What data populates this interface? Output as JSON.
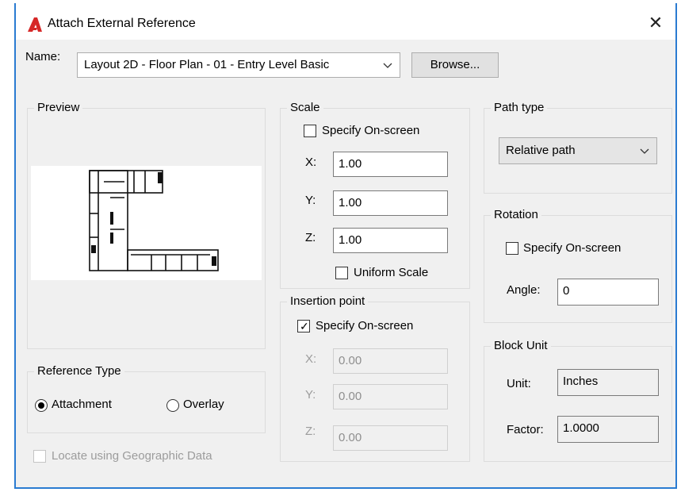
{
  "window": {
    "title": "Attach External Reference",
    "close_glyph": "✕",
    "icon": "autocad-logo-icon",
    "accent": "#2a7bd1",
    "logo_color": "#d62828"
  },
  "name_row": {
    "label": "Name:",
    "value": "Layout 2D - Floor Plan - 01 - Entry Level Basic",
    "browse_label": "Browse..."
  },
  "preview": {
    "title": "Preview"
  },
  "scale": {
    "title": "Scale",
    "specify_label": "Specify On-screen",
    "specify_checked": false,
    "x_label": "X:",
    "x_value": "1.00",
    "y_label": "Y:",
    "y_value": "1.00",
    "z_label": "Z:",
    "z_value": "1.00",
    "uniform_label": "Uniform Scale",
    "uniform_checked": false
  },
  "insertion": {
    "title": "Insertion point",
    "specify_label": "Specify On-screen",
    "specify_checked": true,
    "x_label": "X:",
    "x_value": "0.00",
    "y_label": "Y:",
    "y_value": "0.00",
    "z_label": "Z:",
    "z_value": "0.00"
  },
  "path_type": {
    "title": "Path type",
    "value": "Relative path"
  },
  "rotation": {
    "title": "Rotation",
    "specify_label": "Specify On-screen",
    "specify_checked": false,
    "angle_label": "Angle:",
    "angle_value": "0"
  },
  "block_unit": {
    "title": "Block Unit",
    "unit_label": "Unit:",
    "unit_value": "Inches",
    "factor_label": "Factor:",
    "factor_value": "1.0000"
  },
  "reference_type": {
    "title": "Reference Type",
    "attachment_label": "Attachment",
    "overlay_label": "Overlay",
    "selected": "Attachment"
  },
  "geo": {
    "label": "Locate using Geographic Data",
    "checked": false,
    "enabled": false
  }
}
